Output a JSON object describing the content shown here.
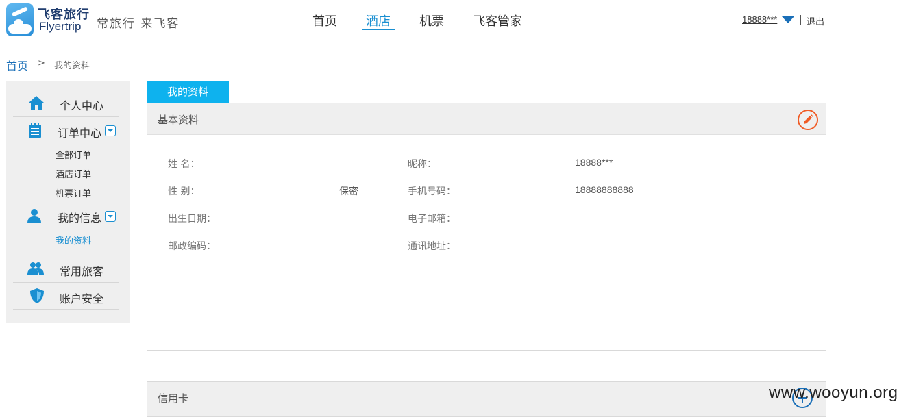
{
  "header": {
    "brand_cn": "飞客旅行",
    "brand_en": "Flyertrip",
    "slogan": "常旅行 来飞客",
    "nav": [
      {
        "label": "首页",
        "active": false
      },
      {
        "label": "酒店",
        "active": true
      },
      {
        "label": "机票",
        "active": false
      },
      {
        "label": "飞客管家",
        "active": false
      }
    ],
    "username": "18888***",
    "logout": "退出"
  },
  "breadcrumb": {
    "home": "首页",
    "separator": ">",
    "current": "我的资料"
  },
  "sidebar": {
    "personal_center": "个人中心",
    "order_center": "订单中心",
    "orders": [
      "全部订单",
      "酒店订单",
      "机票订单"
    ],
    "my_info": "我的信息",
    "my_profile": "我的资料",
    "frequent_travelers": "常用旅客",
    "account_security": "账户安全"
  },
  "main": {
    "tab": "我的资料",
    "basic_title": "基本资料",
    "fields": {
      "name_label": "姓 名：",
      "name_value": "",
      "nickname_label": "昵称：",
      "nickname_value": "18888***",
      "gender_label": "性 别：",
      "gender_value": "保密",
      "phone_label": "手机号码：",
      "phone_value": "18888888888",
      "birthday_label": "出生日期：",
      "email_label": "电子邮箱：",
      "zip_label": "邮政编码：",
      "address_label": "通讯地址："
    },
    "credit_card_title": "信用卡"
  },
  "watermark": "www.wooyun.org",
  "colors": {
    "accent": "#1a8fd1",
    "tab_bg": "#0eb2ee",
    "edit_orange": "#f05b25"
  }
}
